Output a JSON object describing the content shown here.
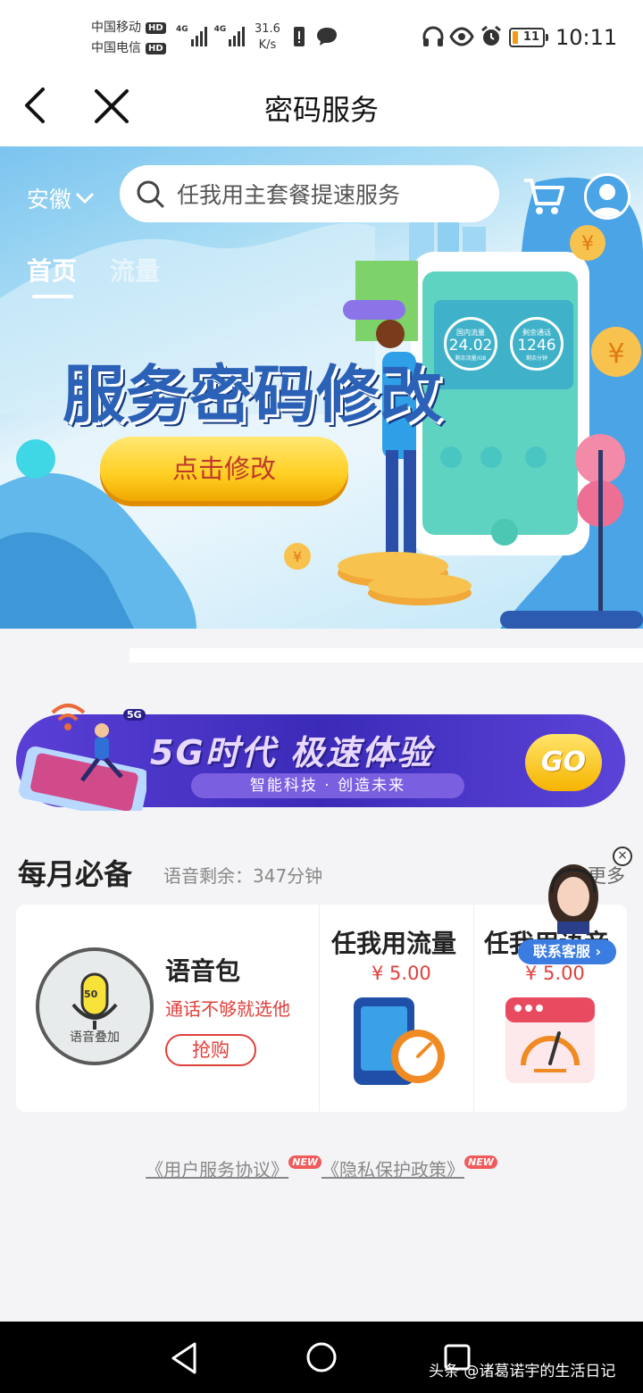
{
  "status_bar": {
    "carrier_1": "中国移动",
    "carrier_2": "中国电信",
    "hd": "HD",
    "network": "4G",
    "speed_value": "31.6",
    "speed_unit": "K/s",
    "battery": "11",
    "time": "10:11"
  },
  "nav": {
    "title": "密码服务"
  },
  "banner": {
    "region": "安徽",
    "search_placeholder": "任我用主套餐提速服务",
    "tabs": [
      {
        "label": "首页",
        "active": true
      },
      {
        "label": "流量",
        "active": false
      }
    ],
    "headline": "服务密码修改",
    "button": "点击修改",
    "phone_stats": [
      {
        "label": "国内流量",
        "value": "24.02",
        "sub": "剩余流量/GB"
      },
      {
        "label": "剩余通话",
        "value": "1246",
        "sub": "剩余分钟"
      }
    ]
  },
  "promo_5g": {
    "badge": "5G",
    "title": "5G时代 极速体验",
    "subtitle": "智能科技 · 创造未来",
    "go": "GO"
  },
  "monthly": {
    "title": "每月必备",
    "voice_remaining": "语音剩余：347分钟",
    "more": "更多",
    "items": [
      {
        "name": "语音包",
        "icon_caption": "语音叠加",
        "icon_badge": "50",
        "desc": "通话不够就选他",
        "button": "抢购"
      },
      {
        "name": "任我用流量",
        "price": "¥ 5.00"
      },
      {
        "name": "任我用语音",
        "price": "¥ 5.00"
      }
    ]
  },
  "customer_service": {
    "label": "联系客服",
    "close": "×"
  },
  "agreements": {
    "items": [
      "《用户服务协议》",
      "《隐私保护政策》"
    ],
    "new_tag": "NEW"
  },
  "watermark": "头条 @诸葛诺宇的生活日记",
  "colors": {
    "accent_red": "#e0403a",
    "banner_blue": "#2b62b8",
    "cs_blue": "#3b7ce0",
    "purple": "#4a35c8"
  }
}
